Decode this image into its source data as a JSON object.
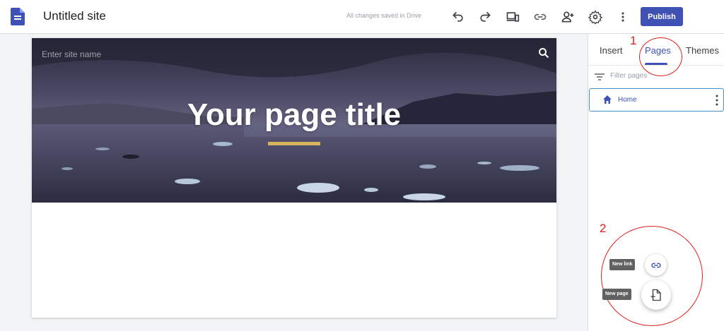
{
  "app": {
    "site_title": "Untitled site",
    "save_status": "All changes saved in Drive",
    "publish_label": "Publish"
  },
  "toolbar_icons": [
    "undo-icon",
    "redo-icon",
    "preview-icon",
    "link-icon",
    "share-icon",
    "settings-icon",
    "more-vert-icon"
  ],
  "header": {
    "site_name_placeholder": "Enter site name",
    "page_title": "Your page title"
  },
  "sidebar": {
    "tabs": [
      {
        "label": "Insert",
        "active": false
      },
      {
        "label": "Pages",
        "active": true
      },
      {
        "label": "Themes",
        "active": false
      }
    ],
    "filter_placeholder": "Filter pages",
    "pages": [
      {
        "label": "Home",
        "icon": "home-icon"
      }
    ]
  },
  "fab": {
    "new_link_tooltip": "New link",
    "new_page_tooltip": "New page"
  },
  "annotations": {
    "first": "1",
    "second": "2"
  },
  "colors": {
    "accent": "#3f51b5",
    "annotation": "#e0201a",
    "title_underline": "#d9b25e"
  }
}
